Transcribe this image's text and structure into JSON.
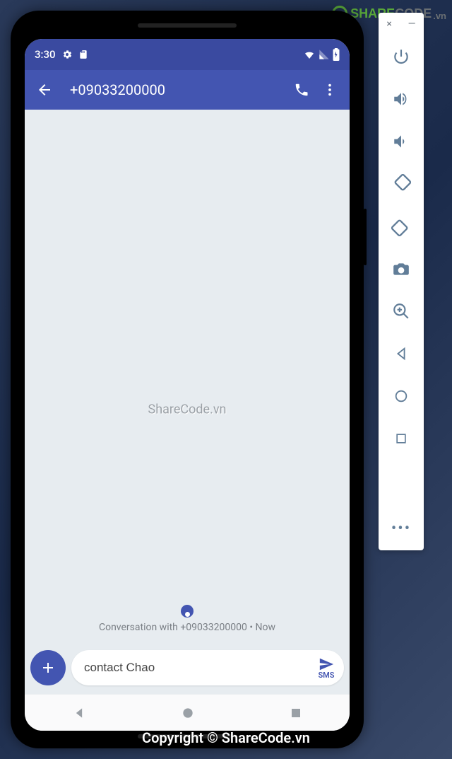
{
  "status_bar": {
    "time": "3:30",
    "icons_left": [
      "gear-icon",
      "sd-card-icon"
    ],
    "icons_right": [
      "wifi-icon",
      "signal-icon",
      "battery-charging-icon"
    ]
  },
  "app_bar": {
    "title": "+09033200000",
    "actions": [
      "call-icon",
      "more-vert-icon"
    ]
  },
  "conversation": {
    "conversation_with": "Conversation with +09033200000 • Now"
  },
  "compose": {
    "message_value": "contact Chao",
    "send_label": "SMS"
  },
  "nav": {
    "buttons": [
      "back",
      "home",
      "overview"
    ]
  },
  "emulator_toolbar": {
    "top": {
      "close": "×",
      "minimize": "—"
    },
    "buttons": [
      "power-icon",
      "volume-up-icon",
      "volume-down-icon",
      "rotate-left-icon",
      "rotate-right-icon",
      "camera-icon",
      "zoom-in-icon",
      "back-icon",
      "home-icon",
      "overview-icon"
    ],
    "more": "•••"
  },
  "watermarks": {
    "center": "ShareCode.vn",
    "logo_share": "SHARE",
    "logo_code": "CODE",
    "logo_vn": ".vn",
    "copyright": "Copyright © ShareCode.vn"
  }
}
